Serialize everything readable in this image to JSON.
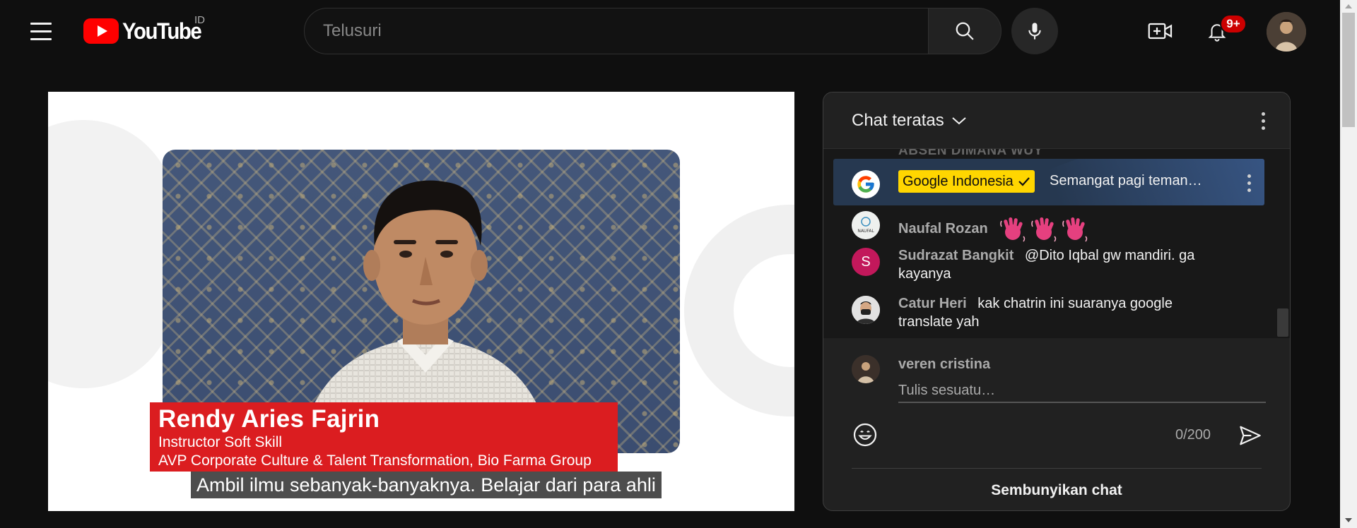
{
  "masthead": {
    "logo_text": "YouTube",
    "country_code": "ID",
    "search_placeholder": "Telusuri",
    "notification_count": "9+",
    "icons": [
      "menu-icon",
      "youtube-logo-icon",
      "search-icon",
      "microphone-icon",
      "create-video-icon",
      "bell-icon"
    ]
  },
  "player": {
    "banner": {
      "name": "Rendy Aries Fajrin",
      "role": "Instructor Soft Skill",
      "position": "AVP Corporate Culture & Talent Transformation, Bio Farma Group"
    },
    "subtitle": "Ambil ilmu sebanyak-banyaknya. Belajar dari para ahli"
  },
  "chat": {
    "title": "Chat teratas",
    "faded_message": "ABSEN DIMANA WUY",
    "pinned": {
      "author": "Google Indonesia",
      "text": "Semangat pagi teman…"
    },
    "messages": [
      {
        "author": "Naufal Rozan",
        "text": "",
        "avatar_letter": "",
        "avatar_label": "NAUFAL",
        "emoji": "waving-hand-icon",
        "emoji_count": 3
      },
      {
        "author": "Sudrazat Bangkit",
        "text": "@Dito Iqbal gw mandiri. ga kayanya",
        "avatar_letter": "S",
        "avatar_label": ""
      },
      {
        "author": "Catur Heri",
        "text": "kak chatrin ini suaranya google translate yah",
        "avatar_letter": "",
        "avatar_label": ""
      }
    ],
    "input": {
      "user_name": "veren cristina",
      "placeholder": "Tulis sesuatu…",
      "char_count": "0/200"
    },
    "hide_label": "Sembunyikan chat"
  },
  "colors": {
    "background": "#0f0f0f",
    "youtube_red": "#ff0000",
    "owner_badge": "#ffd600",
    "pinned_bg": "#263850",
    "banner_red": "#db1d20",
    "notif_badge": "#cc0000",
    "avatar_s": "#c2185b"
  }
}
